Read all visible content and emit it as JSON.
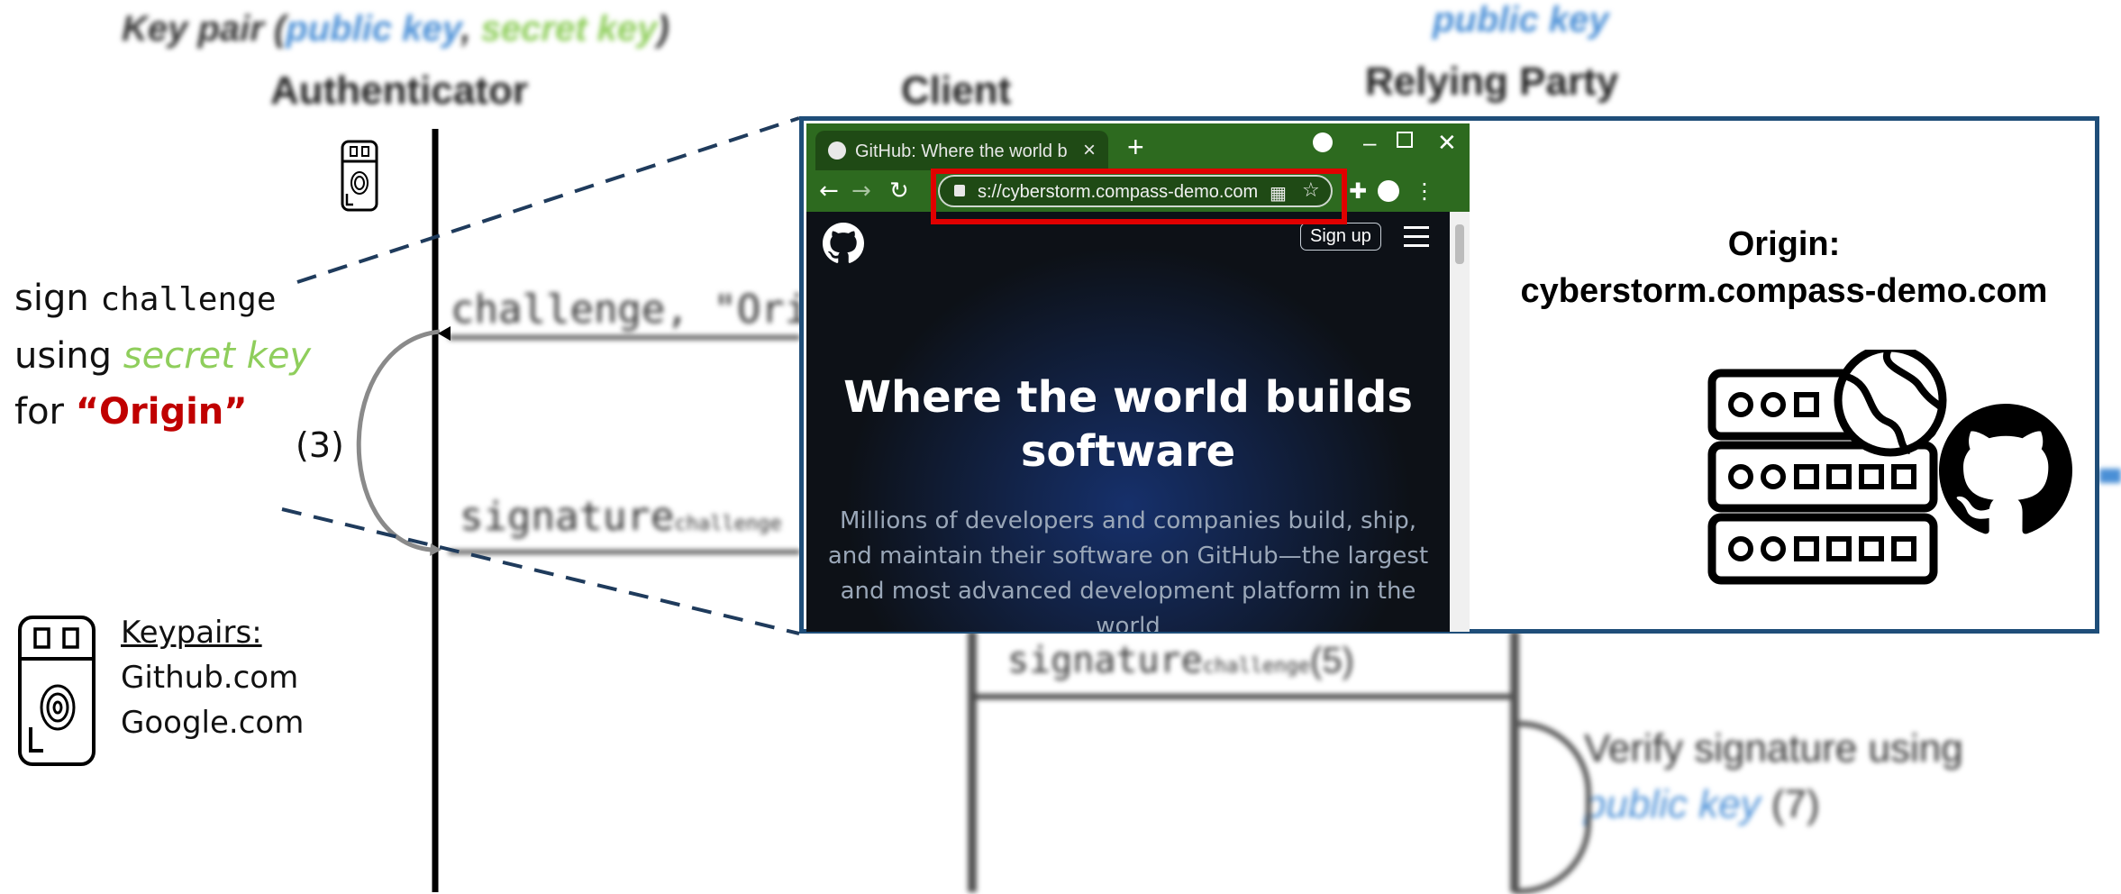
{
  "diagram": {
    "background": {
      "keypair_prefix": "Key pair (",
      "keypair_public": "public key",
      "keypair_sep": ", ",
      "keypair_secret": "secret key",
      "keypair_suffix": ")",
      "authenticator": "Authenticator",
      "client": "Client",
      "relying_party_public": "public key",
      "relying_party": "Relying Party",
      "challenge_msg": "challenge, \"Origin\"",
      "signature_msg": "signature",
      "signature_sub": "challenge",
      "signature_step": "(5)",
      "verify_text": "Verify signature using",
      "verify_public": "public key",
      "verify_step": "(7)"
    },
    "left": {
      "line1_prefix": "sign ",
      "line1_code": "challenge",
      "line2_prefix": "using ",
      "line2_secret": "secret key",
      "line3_prefix": "for ",
      "line3_origin": "“Origin”",
      "step": "(3)",
      "keypairs_head": "Keypairs:",
      "keypairs": [
        "Github.com",
        "Google.com"
      ]
    },
    "browser": {
      "tab_title": "GitHub: Where the world b",
      "tab_close": "×",
      "new_tab": "+",
      "url": "s://cyberstorm.compass-demo.com",
      "signup": "Sign up",
      "hero_line1": "Where the world builds",
      "hero_line2": "software",
      "lead": "Millions of developers and companies build, ship, and maintain their software on GitHub—the largest and most advanced development platform in the world"
    },
    "origin_panel": {
      "label": "Origin:",
      "domain": "cyberstorm.compass-demo.com"
    },
    "colors": {
      "frame": "#1f4e79",
      "highlight": "#e00000",
      "secret_green": "#8fce5c",
      "origin_red": "#c00000",
      "public_blue": "#4a8fd6",
      "chrome_green": "#2d6a1f"
    }
  }
}
